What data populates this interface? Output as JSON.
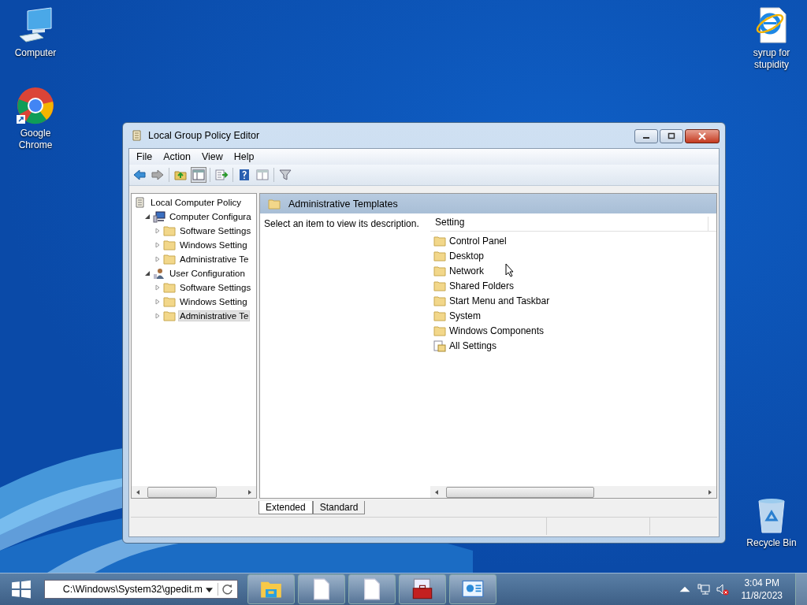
{
  "desktop_icons": [
    {
      "label": "Computer",
      "kind": "computer"
    },
    {
      "label": "Google Chrome",
      "kind": "chrome"
    },
    {
      "label": "syrup for stupidity",
      "kind": "ie-file"
    },
    {
      "label": "Recycle Bin",
      "kind": "recycle"
    }
  ],
  "window": {
    "title": "Local Group Policy Editor",
    "menu": [
      "File",
      "Action",
      "View",
      "Help"
    ],
    "tree": [
      {
        "label": "Local Computer Policy",
        "kind": "policy",
        "selected": false,
        "children": [
          {
            "label": "Computer Configura",
            "kind": "computer",
            "expanded": true,
            "selected": false,
            "children": [
              {
                "label": "Software Settings",
                "kind": "folder",
                "expanded": false,
                "selected": false
              },
              {
                "label": "Windows Setting",
                "kind": "folder",
                "expanded": false,
                "selected": false
              },
              {
                "label": "Administrative Te",
                "kind": "folder",
                "expanded": false,
                "selected": false
              }
            ]
          },
          {
            "label": "User Configuration",
            "kind": "user",
            "expanded": true,
            "selected": false,
            "children": [
              {
                "label": "Software Settings",
                "kind": "folder",
                "expanded": false,
                "selected": false
              },
              {
                "label": "Windows Setting",
                "kind": "folder",
                "expanded": false,
                "selected": false
              },
              {
                "label": "Administrative Te",
                "kind": "folder",
                "expanded": false,
                "selected": true
              }
            ]
          }
        ]
      }
    ],
    "header": "Administrative Templates",
    "description": "Select an item to view its description.",
    "column": "Setting",
    "items": [
      {
        "label": "Control Panel",
        "kind": "folder"
      },
      {
        "label": "Desktop",
        "kind": "folder"
      },
      {
        "label": "Network",
        "kind": "folder"
      },
      {
        "label": "Shared Folders",
        "kind": "folder"
      },
      {
        "label": "Start Menu and Taskbar",
        "kind": "folder"
      },
      {
        "label": "System",
        "kind": "folder"
      },
      {
        "label": "Windows Components",
        "kind": "folder"
      },
      {
        "label": "All Settings",
        "kind": "settings"
      }
    ],
    "tabs": [
      {
        "label": "Extended",
        "selected": true
      },
      {
        "label": "Standard",
        "selected": false
      }
    ]
  },
  "taskbar": {
    "address": "C:\\Windows\\System32\\gpedit.m",
    "apps": [
      {
        "kind": "explorer"
      },
      {
        "kind": "document"
      },
      {
        "kind": "document"
      },
      {
        "kind": "toolbox"
      },
      {
        "kind": "control-panel"
      }
    ],
    "time": "3:04 PM",
    "date": "11/8/2023"
  }
}
